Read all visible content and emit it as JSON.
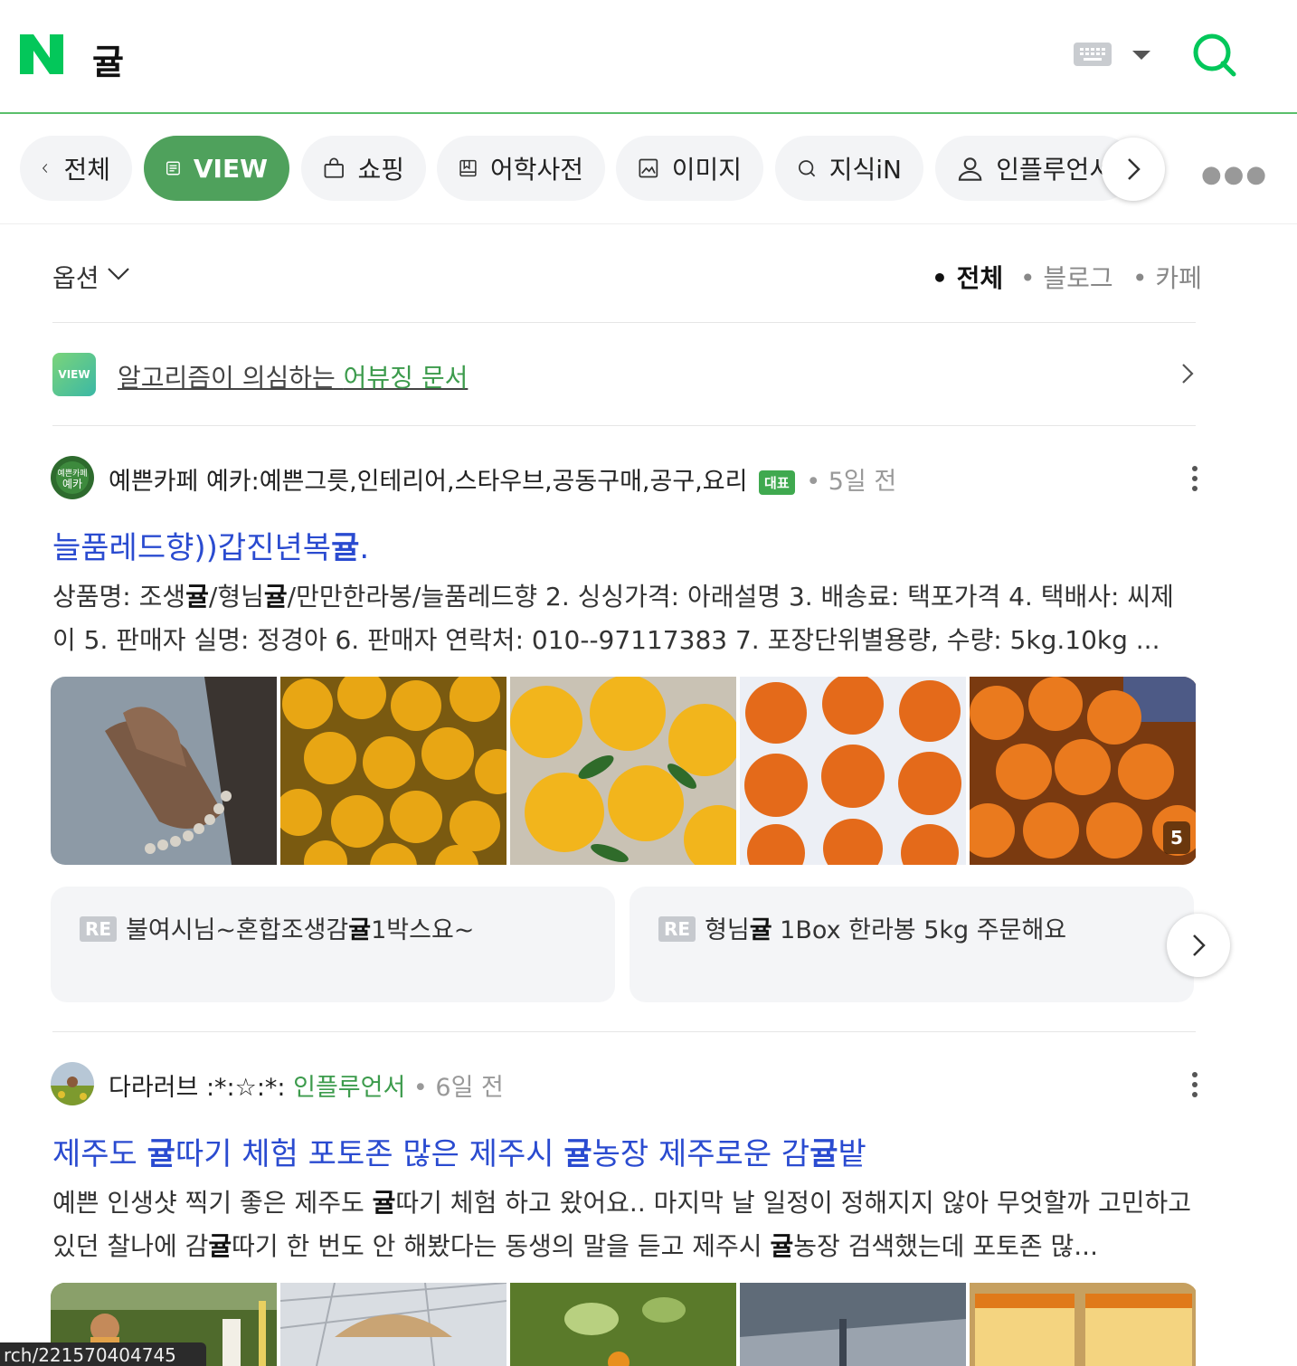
{
  "header": {
    "query": "귤"
  },
  "tabs": [
    {
      "label": "전체"
    },
    {
      "label": "VIEW"
    },
    {
      "label": "쇼핑"
    },
    {
      "label": "어학사전"
    },
    {
      "label": "이미지"
    },
    {
      "label": "지식iN"
    },
    {
      "label": "인플루언서"
    }
  ],
  "options": {
    "label": "옵션",
    "filters": [
      "• 전체",
      "• 블로그",
      "• 카페"
    ]
  },
  "notice": {
    "badge": "VIEW",
    "text_prefix": "알고리즘이 의심하는 ",
    "text_link": "어뷰징 문서"
  },
  "post1": {
    "author": "예쁜카페 예카:예쁜그릇,인테리어,스타우브,공동구매,공구,요리",
    "badge": "대표",
    "time": "• 5일 전",
    "title_a": "늘품레드향))갑진년복",
    "title_b": "귤",
    "title_c": ".",
    "snippet_1": "상품명: 조생",
    "snippet_2": "귤",
    "snippet_3": "/형님",
    "snippet_4": "귤",
    "snippet_5": "/만만한라봉/늘품레드향 2. 싱싱가격: 아래설명 3. 배송료: 택포가격 4. 택배사: 씨제이 5. 판매자 실명: 정경아 6. 판매자 연락처: 010--97117383 7. 포장단위별용량, 수량: 5kg.10kg ...",
    "image_count": "5",
    "replies": [
      {
        "tag": "RE",
        "a": "불여시님~혼합조생감",
        "b": "귤",
        "c": "1박스요~"
      },
      {
        "tag": "RE",
        "a": "형님",
        "b": "귤",
        "c": " 1Box 한라봉 5kg 주문해요"
      }
    ]
  },
  "post2": {
    "author": "다라러브 :*:☆:*: ",
    "influencer": "인플루언서",
    "time": " • 6일 전",
    "title_parts": [
      "제주도 ",
      "귤",
      "따기 체험 포토존 많은 제주시 ",
      "귤",
      "농장 제주로운 감",
      "귤",
      "밭"
    ],
    "snippet_parts": [
      "예쁜 인생샷 찍기 좋은 제주도 ",
      "귤",
      "따기 체험 하고 왔어요.. 마지막 날 일정이 정해지지 않아 무엇할까 고민하고 있던 찰나에 감",
      "귤",
      "따기 한 번도 안 해봤다는 동생의 말을 듣고 제주시 ",
      "귤",
      "농장 검색했는데 포토존 많..."
    ]
  },
  "status_url": "rch/221570404745"
}
